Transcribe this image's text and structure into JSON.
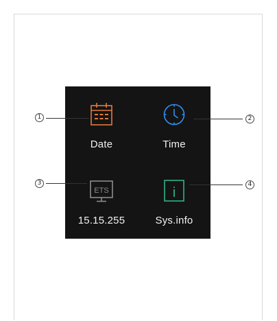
{
  "screen": {
    "tiles": [
      {
        "label": "Date",
        "icon": "calendar-icon",
        "color": "#e9783b"
      },
      {
        "label": "Time",
        "icon": "clock-icon",
        "color": "#2f8ff0"
      },
      {
        "label": "15.15.255",
        "icon": "ets-monitor-icon",
        "icon_text": "ETS",
        "color": "#8c8c8c"
      },
      {
        "label": "Sys.info",
        "icon": "info-icon",
        "icon_text": "i",
        "color": "#2fb38a"
      }
    ]
  },
  "callouts": [
    "1",
    "2",
    "3",
    "4"
  ]
}
